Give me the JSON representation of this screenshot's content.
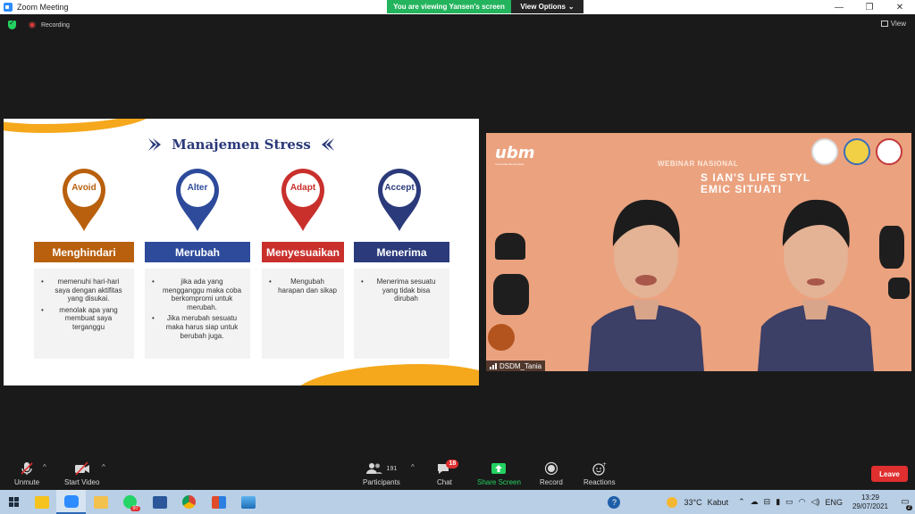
{
  "window": {
    "title": "Zoom Meeting",
    "minimize": "—",
    "maximize": "❐",
    "close": "✕"
  },
  "share": {
    "viewing_text": "You are viewing Yansen's screen",
    "options_label": "View Options",
    "options_caret": "⌄"
  },
  "status": {
    "recording_label": "Recording",
    "view_label": "View"
  },
  "slide": {
    "title": "Manajemen Stress",
    "columns": [
      {
        "pin": "Avoid",
        "label": "Menghindari",
        "color": "#b8600e",
        "items": [
          "memenuhi hari-hari saya dengan aktifitas yang disukai.",
          "menolak apa yang membuat saya terganggu"
        ]
      },
      {
        "pin": "Alter",
        "label": "Merubah",
        "color": "#2d4a9b",
        "items": [
          "jika ada yang mengganggu maka coba berkompromi untuk merubah.",
          "Jika merubah sesuatu maka harus siap untuk berubah juga."
        ]
      },
      {
        "pin": "Adapt",
        "label": "Menyesuaikan",
        "color": "#c9302c",
        "items": [
          "Mengubah harapan dan sikap"
        ]
      },
      {
        "pin": "Accept",
        "label": "Menerima",
        "color": "#2b3a7a",
        "items": [
          "Menerima sesuatu yang tidak bisa dirubah"
        ]
      }
    ]
  },
  "webcam": {
    "logo": "ubm",
    "logo_sub": "Universitas Bunda Mulia",
    "webinar_label": "WEBINAR NASIONAL",
    "banner_line1": "S     IAN'S LIFE STYL",
    "banner_line2": "      EMIC SITUATI",
    "participant_name": "DSDM_Tania"
  },
  "toolbar": {
    "unmute": "Unmute",
    "start_video": "Start Video",
    "participants": "Participants",
    "participants_count": "191",
    "chat": "Chat",
    "chat_badge": "18",
    "share_screen": "Share Screen",
    "record": "Record",
    "reactions": "Reactions",
    "leave": "Leave"
  },
  "taskbar": {
    "whatsapp_badge": "97",
    "help": "?",
    "temperature": "33°C",
    "weather": "Kabut",
    "language": "ENG",
    "time": "13:29",
    "date": "29/07/2021",
    "notifications": "2"
  },
  "colors": {
    "accent_green": "#23d160",
    "leave_red": "#e02f2f",
    "title_blue": "#2b3a7a",
    "swoosh_orange": "#f5a81c"
  }
}
